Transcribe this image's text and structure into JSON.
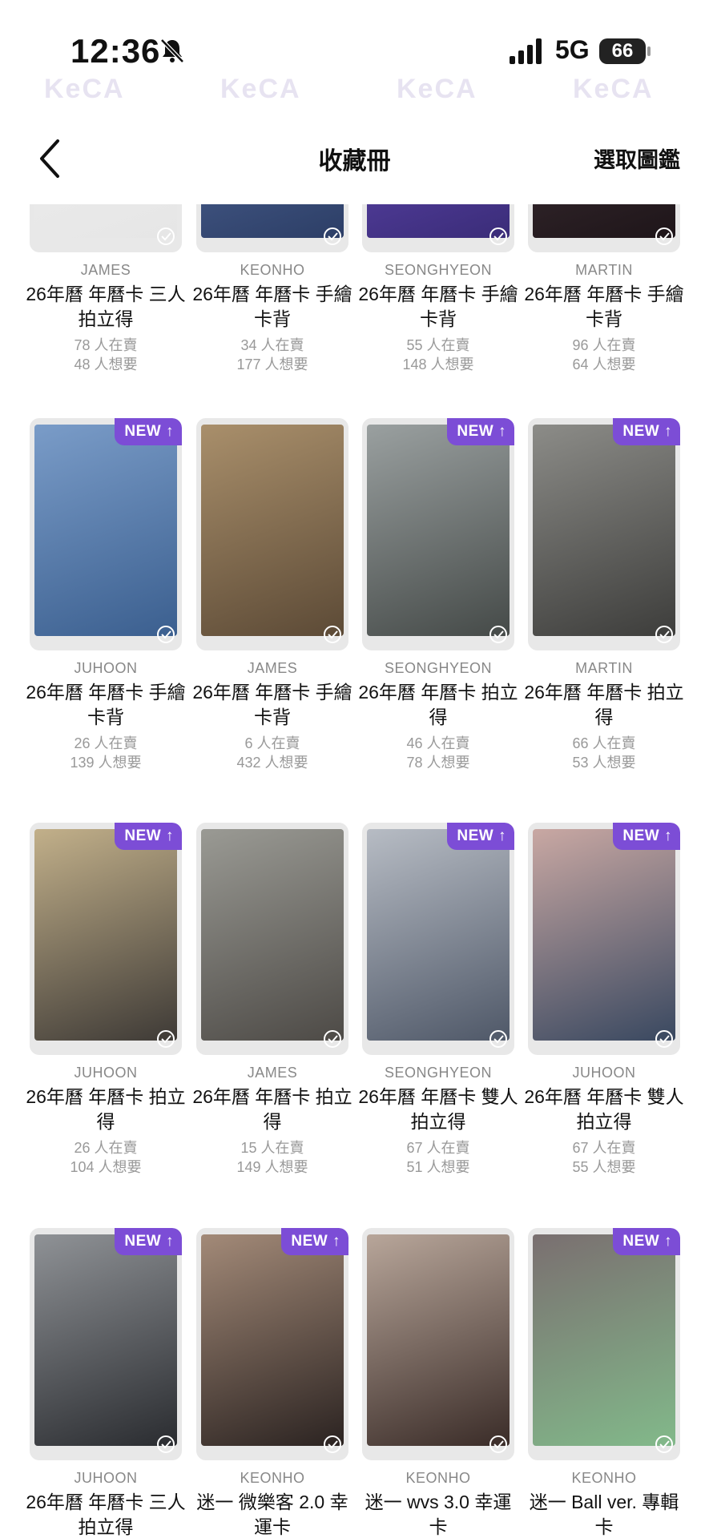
{
  "status_bar": {
    "time": "12:36",
    "network": "5G",
    "battery": "66",
    "icons": [
      "bell-slash-icon",
      "signal-bars-icon",
      "battery-icon"
    ]
  },
  "watermark_text": "KeCA",
  "header": {
    "back_icon": "chevron-left-icon",
    "title": "收藏冊",
    "select_label": "選取圖鑑"
  },
  "colors": {
    "accent": "#7c4dd6",
    "text": "#111111",
    "muted": "#888888"
  },
  "new_badge_label": "NEW",
  "cards": [
    {
      "member": "JAMES",
      "name": "26年曆 年曆卡 三人拍立得",
      "selling": "78 人在賣",
      "wanting": "48 人想要",
      "is_new": false,
      "photo_colors": [
        "#f0f0f0",
        "#e6e6e6"
      ]
    },
    {
      "member": "KEONHO",
      "name": "26年曆 年曆卡 手繪卡背",
      "selling": "34 人在賣",
      "wanting": "177 人想要",
      "is_new": false,
      "photo_colors": [
        "#5d74a8",
        "#2c3e66"
      ]
    },
    {
      "member": "SEONGHYEON",
      "name": "26年曆 年曆卡 手繪卡背",
      "selling": "55 人在賣",
      "wanting": "148 人想要",
      "is_new": false,
      "photo_colors": [
        "#7052c7",
        "#3a2c78"
      ]
    },
    {
      "member": "MARTIN",
      "name": "26年曆 年曆卡 手繪卡背",
      "selling": "96 人在賣",
      "wanting": "64 人想要",
      "is_new": false,
      "photo_colors": [
        "#4a3a40",
        "#1e1519"
      ]
    },
    {
      "member": "JUHOON",
      "name": "26年曆 年曆卡 手繪卡背",
      "selling": "26 人在賣",
      "wanting": "139 人想要",
      "is_new": true,
      "photo_colors": [
        "#7a9cc8",
        "#3b5f8f"
      ]
    },
    {
      "member": "JAMES",
      "name": "26年曆 年曆卡 手繪卡背",
      "selling": "6 人在賣",
      "wanting": "432 人想要",
      "is_new": false,
      "photo_colors": [
        "#a98f6b",
        "#5c4a36"
      ]
    },
    {
      "member": "SEONGHYEON",
      "name": "26年曆 年曆卡 拍立得",
      "selling": "46 人在賣",
      "wanting": "78 人想要",
      "is_new": true,
      "photo_colors": [
        "#9aa0a0",
        "#454a48"
      ]
    },
    {
      "member": "MARTIN",
      "name": "26年曆 年曆卡 拍立得",
      "selling": "66 人在賣",
      "wanting": "53 人想要",
      "is_new": true,
      "photo_colors": [
        "#8c8c88",
        "#3d3d3b"
      ]
    },
    {
      "member": "JUHOON",
      "name": "26年曆 年曆卡 拍立得",
      "selling": "26 人在賣",
      "wanting": "104 人想要",
      "is_new": true,
      "photo_colors": [
        "#c2b08a",
        "#3e3a36"
      ]
    },
    {
      "member": "JAMES",
      "name": "26年曆 年曆卡 拍立得",
      "selling": "15 人在賣",
      "wanting": "149 人想要",
      "is_new": false,
      "photo_colors": [
        "#9a9a94",
        "#4d4a46"
      ]
    },
    {
      "member": "SEONGHYEON",
      "name": "26年曆 年曆卡 雙人拍立得",
      "selling": "67 人在賣",
      "wanting": "51 人想要",
      "is_new": true,
      "photo_colors": [
        "#b7bcc4",
        "#4f5868"
      ]
    },
    {
      "member": "JUHOON",
      "name": "26年曆 年曆卡 雙人拍立得",
      "selling": "67 人在賣",
      "wanting": "55 人想要",
      "is_new": true,
      "photo_colors": [
        "#c9a8a3",
        "#394860"
      ]
    },
    {
      "member": "JUHOON",
      "name": "26年曆 年曆卡 三人拍立得",
      "selling": "",
      "wanting": "",
      "is_new": true,
      "photo_colors": [
        "#8f9296",
        "#2a2c30"
      ]
    },
    {
      "member": "KEONHO",
      "name": "迷一 微樂客 2.0 幸運卡",
      "selling": "",
      "wanting": "",
      "is_new": true,
      "photo_colors": [
        "#a38a78",
        "#2b2321"
      ]
    },
    {
      "member": "KEONHO",
      "name": "迷一 wvs 3.0 幸運卡",
      "selling": "",
      "wanting": "",
      "is_new": false,
      "photo_colors": [
        "#b8a69a",
        "#3a2c28"
      ]
    },
    {
      "member": "KEONHO",
      "name": "迷一 Ball ver. 專輯卡",
      "selling": "",
      "wanting": "",
      "is_new": true,
      "photo_colors": [
        "#7a6f70",
        "#82b98a"
      ]
    }
  ]
}
